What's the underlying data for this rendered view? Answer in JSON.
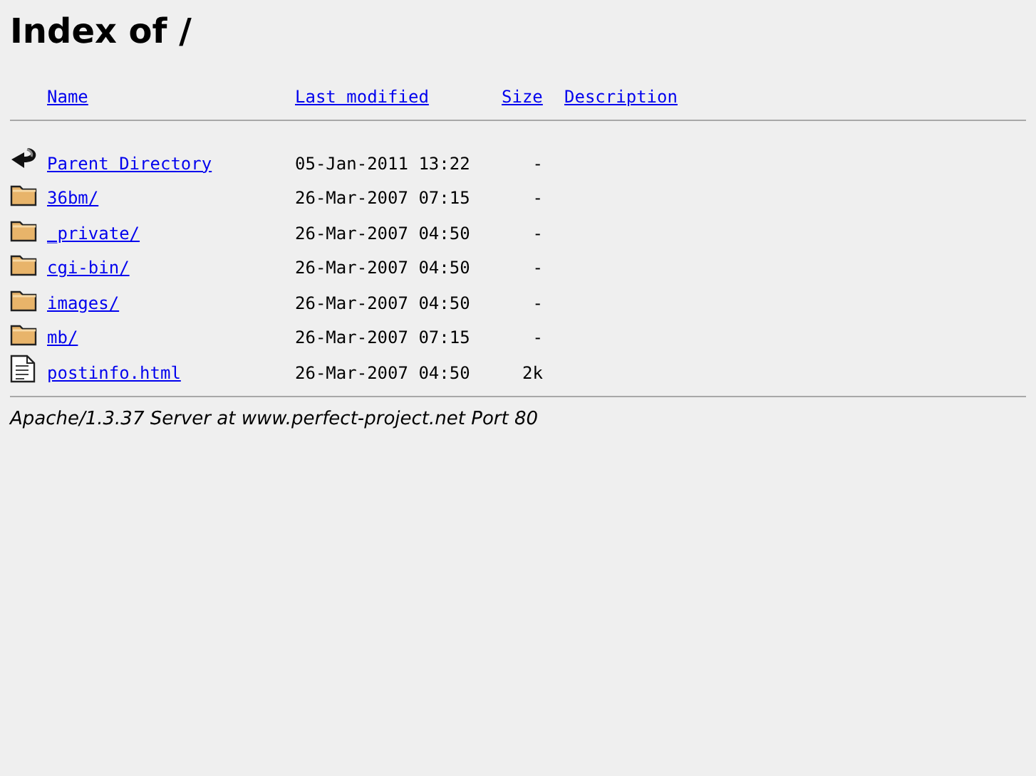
{
  "title": "Index of /",
  "columns": [
    "Name",
    "Last modified",
    "Size",
    "Description"
  ],
  "rows": [
    {
      "kind": "parent",
      "name": "Parent Directory",
      "modified": "05-Jan-2011 13:22",
      "size": "-"
    },
    {
      "kind": "folder",
      "name": "36bm/",
      "modified": "26-Mar-2007 07:15",
      "size": "-"
    },
    {
      "kind": "folder",
      "name": "_private/",
      "modified": "26-Mar-2007 04:50",
      "size": "-"
    },
    {
      "kind": "folder",
      "name": "cgi-bin/",
      "modified": "26-Mar-2007 04:50",
      "size": "-"
    },
    {
      "kind": "folder",
      "name": "images/",
      "modified": "26-Mar-2007 04:50",
      "size": "-"
    },
    {
      "kind": "folder",
      "name": "mb/",
      "modified": "26-Mar-2007 07:15",
      "size": "-"
    },
    {
      "kind": "file",
      "name": "postinfo.html",
      "modified": "26-Mar-2007 04:50",
      "size": "2k"
    }
  ],
  "footer": "Apache/1.3.37 Server at www.perfect-project.net Port 80"
}
